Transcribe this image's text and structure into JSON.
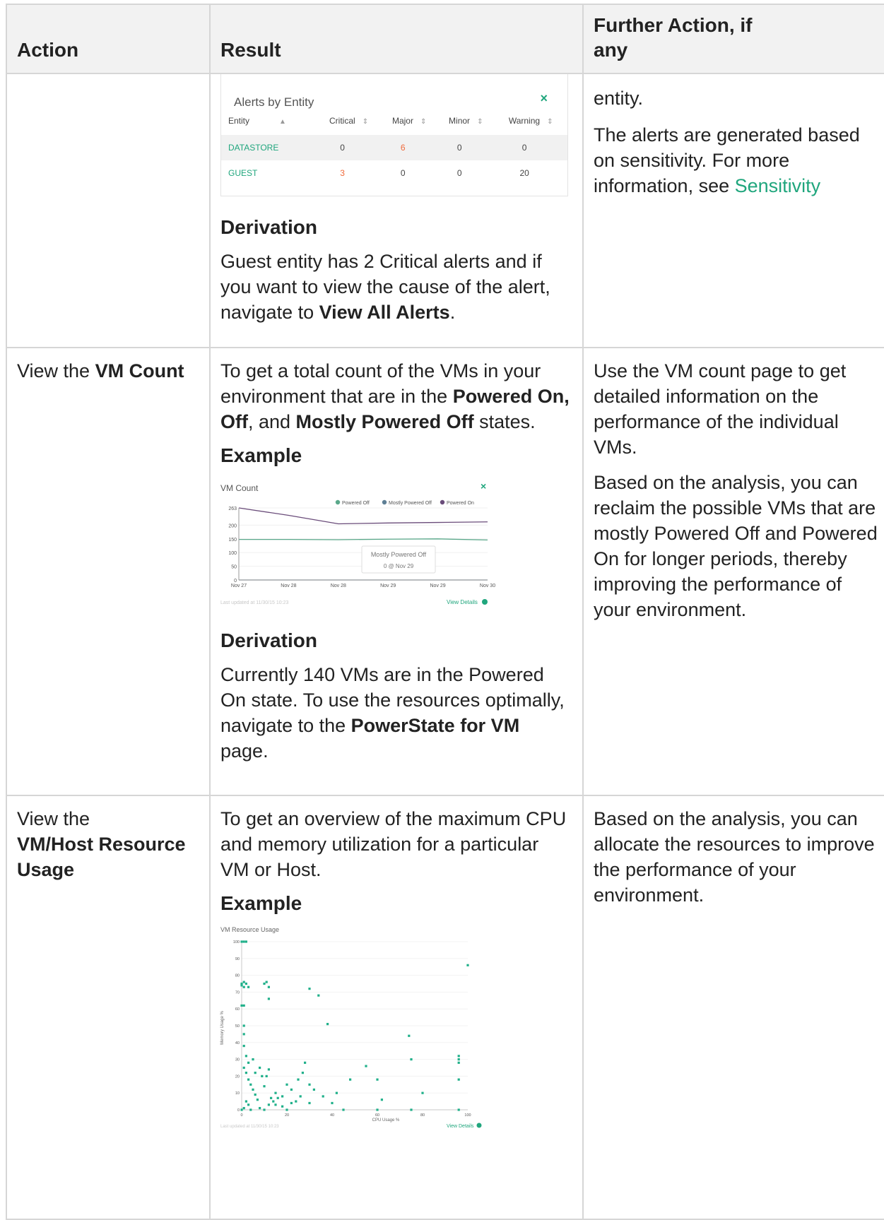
{
  "headers": {
    "action": "Action",
    "result": "Result",
    "further": "Further Action, if any"
  },
  "row1": {
    "widget": {
      "title": "Alerts by Entity",
      "close": "×",
      "columns": [
        "Entity",
        "Critical",
        "Major",
        "Minor",
        "Warning"
      ],
      "rows": [
        {
          "entity": "DATASTORE",
          "critical": "0",
          "major": "6",
          "minor": "0",
          "warning": "0"
        },
        {
          "entity": "GUEST",
          "critical": "3",
          "major": "0",
          "minor": "0",
          "warning": "20"
        }
      ]
    },
    "derivation_heading": "Derivation",
    "derivation_text_a": "Guest entity has 2 Critical alerts and if you want to view the cause of the alert, navigate to ",
    "derivation_bold": "View All Alerts",
    "derivation_text_b": ".",
    "further_p1": "entity.",
    "further_p2": "The alerts are generated based on sensitivity. For more information, see ",
    "further_link": "Sensitivity"
  },
  "row2": {
    "action_text": "View the ",
    "action_bold": "VM Count",
    "result_text_a": "To get a total count of the VMs in your environment that are in the ",
    "result_bold_a": "Powered On, Off",
    "result_text_b": ", and ",
    "result_bold_b": "Mostly Powered Off",
    "result_text_c": " states.",
    "example_heading": "Example",
    "derivation_heading": "Derivation",
    "derivation_text_a": "Currently 140 VMs are in the Powered On state. To use the resources optimally, navigate to the ",
    "derivation_bold": "PowerState for VM",
    "derivation_text_b": " page.",
    "further_p1": "Use the VM count page to get detailed information on the performance of the individual VMs.",
    "further_p2": "Based on the analysis, you can reclaim the possible VMs that are mostly Powered Off and Powered On for longer periods, thereby improving the performance of your environment.",
    "chart": {
      "title": "VM Count",
      "close": "×",
      "legend": [
        "Powered Off",
        "Mostly Powered Off",
        "Powered On"
      ],
      "tooltip_title": "Mostly Powered Off",
      "tooltip_value": "0 @ Nov 29",
      "footer_left": "Last updated at 11/30/15 10:23",
      "footer_right": "View Details",
      "colors": {
        "powered_off": "#5aa88a",
        "mostly_powered_off": "#5e7f95",
        "powered_on": "#6a4c7a"
      }
    }
  },
  "row3": {
    "action_text": "View the ",
    "action_bold": "VM/Host Resource Usage",
    "result_text": "To get an overview of the maximum CPU and memory utilization for a particular VM or Host.",
    "example_heading": "Example",
    "further_p1": "Based on the analysis, you can allocate the resources to improve the performance of your environment.",
    "chart": {
      "title": "VM Resource Usage",
      "xlabel": "CPU Usage %",
      "ylabel": "Memory Usage %",
      "footer_left": "Last updated at 11/30/15 10:23",
      "footer_right": "View Details",
      "color": "#20b08a"
    }
  },
  "chart_data": [
    {
      "type": "line",
      "title": "VM Count",
      "x": [
        "Nov 27",
        "Nov 28",
        "Nov 28",
        "Nov 29",
        "Nov 29",
        "Nov 30"
      ],
      "yticks": [
        0,
        50,
        100,
        150,
        200,
        263
      ],
      "ylim": [
        0,
        263
      ],
      "series": [
        {
          "name": "Powered On",
          "values": [
            263,
            236,
            205,
            208,
            210,
            212
          ]
        },
        {
          "name": "Mostly Powered Off",
          "values": [
            0,
            0,
            0,
            0,
            0,
            0
          ]
        },
        {
          "name": "Powered Off",
          "values": [
            148,
            148,
            147,
            149,
            150,
            146
          ]
        }
      ]
    },
    {
      "type": "scatter",
      "title": "VM Resource Usage",
      "xlabel": "CPU Usage %",
      "ylabel": "Memory Usage %",
      "xlim": [
        0,
        100
      ],
      "ylim": [
        0,
        100
      ],
      "xticks": [
        0,
        20,
        40,
        60,
        80,
        100
      ],
      "yticks": [
        0,
        10,
        20,
        30,
        40,
        50,
        60,
        70,
        80,
        90,
        100
      ],
      "points": [
        [
          0,
          100
        ],
        [
          1,
          100
        ],
        [
          2,
          100
        ],
        [
          0,
          75
        ],
        [
          0,
          74
        ],
        [
          1,
          76
        ],
        [
          2,
          75
        ],
        [
          3,
          73
        ],
        [
          1,
          73
        ],
        [
          10,
          75
        ],
        [
          11,
          76
        ],
        [
          12,
          73
        ],
        [
          1,
          62
        ],
        [
          0,
          62
        ],
        [
          12,
          66
        ],
        [
          30,
          72
        ],
        [
          34,
          68
        ],
        [
          38,
          51
        ],
        [
          1,
          50
        ],
        [
          1,
          45
        ],
        [
          1,
          38
        ],
        [
          2,
          32
        ],
        [
          3,
          28
        ],
        [
          1,
          25
        ],
        [
          2,
          22
        ],
        [
          3,
          18
        ],
        [
          4,
          15
        ],
        [
          5,
          12
        ],
        [
          6,
          9
        ],
        [
          7,
          6
        ],
        [
          2,
          5
        ],
        [
          3,
          3
        ],
        [
          1,
          1
        ],
        [
          0,
          0
        ],
        [
          4,
          0
        ],
        [
          8,
          1
        ],
        [
          10,
          0
        ],
        [
          12,
          3
        ],
        [
          14,
          5
        ],
        [
          15,
          10
        ],
        [
          18,
          8
        ],
        [
          20,
          15
        ],
        [
          22,
          12
        ],
        [
          25,
          18
        ],
        [
          27,
          22
        ],
        [
          28,
          28
        ],
        [
          30,
          15
        ],
        [
          32,
          12
        ],
        [
          24,
          5
        ],
        [
          26,
          8
        ],
        [
          30,
          4
        ],
        [
          36,
          8
        ],
        [
          40,
          4
        ],
        [
          42,
          10
        ],
        [
          48,
          18
        ],
        [
          55,
          26
        ],
        [
          60,
          18
        ],
        [
          62,
          6
        ],
        [
          75,
          30
        ],
        [
          74,
          44
        ],
        [
          80,
          10
        ],
        [
          96,
          32
        ],
        [
          96,
          30
        ],
        [
          96,
          28
        ],
        [
          96,
          18
        ],
        [
          100,
          86
        ],
        [
          5,
          30
        ],
        [
          6,
          22
        ],
        [
          8,
          25
        ],
        [
          9,
          20
        ],
        [
          10,
          14
        ],
        [
          11,
          20
        ],
        [
          12,
          24
        ],
        [
          13,
          7
        ],
        [
          15,
          3
        ],
        [
          16,
          7
        ],
        [
          18,
          2
        ],
        [
          20,
          0
        ],
        [
          22,
          4
        ],
        [
          45,
          0
        ],
        [
          60,
          0
        ],
        [
          75,
          0
        ],
        [
          96,
          0
        ]
      ]
    }
  ]
}
